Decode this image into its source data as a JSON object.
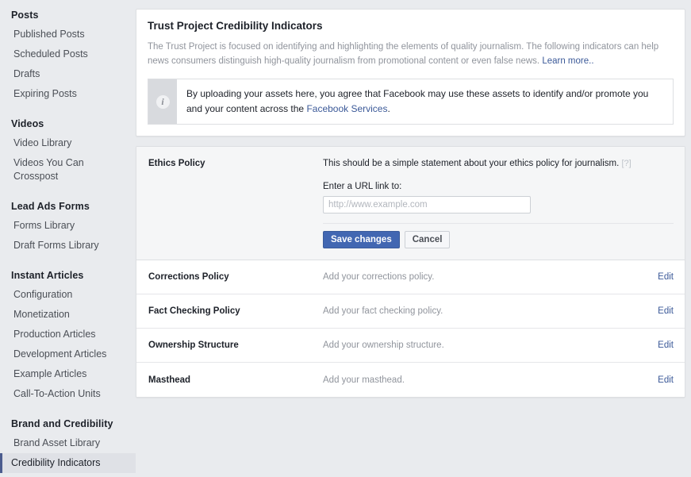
{
  "sidebar": {
    "groups": [
      {
        "header": "Posts",
        "items": [
          {
            "label": "Published Posts",
            "selected": false
          },
          {
            "label": "Scheduled Posts",
            "selected": false
          },
          {
            "label": "Drafts",
            "selected": false
          },
          {
            "label": "Expiring Posts",
            "selected": false
          }
        ]
      },
      {
        "header": "Videos",
        "items": [
          {
            "label": "Video Library",
            "selected": false
          },
          {
            "label": "Videos You Can Crosspost",
            "selected": false
          }
        ]
      },
      {
        "header": "Lead Ads Forms",
        "items": [
          {
            "label": "Forms Library",
            "selected": false
          },
          {
            "label": "Draft Forms Library",
            "selected": false
          }
        ]
      },
      {
        "header": "Instant Articles",
        "items": [
          {
            "label": "Configuration",
            "selected": false
          },
          {
            "label": "Monetization",
            "selected": false
          },
          {
            "label": "Production Articles",
            "selected": false
          },
          {
            "label": "Development Articles",
            "selected": false
          },
          {
            "label": "Example Articles",
            "selected": false
          },
          {
            "label": "Call-To-Action Units",
            "selected": false
          }
        ]
      },
      {
        "header": "Brand and Credibility",
        "items": [
          {
            "label": "Brand Asset Library",
            "selected": false
          },
          {
            "label": "Credibility Indicators",
            "selected": true
          }
        ]
      }
    ]
  },
  "intro": {
    "title": "Trust Project Credibility Indicators",
    "body": "The Trust Project is focused on identifying and highlighting the elements of quality journalism. The following indicators can help news consumers distinguish high-quality journalism from promotional content or even false news.",
    "learn_more": "Learn more..",
    "notice": {
      "icon": "info-icon",
      "text_before": "By uploading your assets here, you agree that Facebook may use these assets to identify and/or promote you and your content across the ",
      "link": "Facebook Services",
      "text_after": "."
    }
  },
  "ethics_section": {
    "label": "Ethics Policy",
    "description": "This should be a simple statement about your ethics policy for journalism.",
    "help": "[?]",
    "field_label": "Enter a URL link to:",
    "input_value": "",
    "input_placeholder": "http://www.example.com",
    "save_label": "Save changes",
    "cancel_label": "Cancel"
  },
  "rows": [
    {
      "label": "Corrections Policy",
      "desc": "Add your corrections policy.",
      "action": "Edit"
    },
    {
      "label": "Fact Checking Policy",
      "desc": "Add your fact checking policy.",
      "action": "Edit"
    },
    {
      "label": "Ownership Structure",
      "desc": "Add your ownership structure.",
      "action": "Edit"
    },
    {
      "label": "Masthead",
      "desc": "Add your masthead.",
      "action": "Edit"
    }
  ],
  "colors": {
    "page_bg": "#e9ebee",
    "card_bg": "#ffffff",
    "accent_link": "#3b5998",
    "primary_button": "#4267b2",
    "selected_border": "#4b5c8e",
    "muted_text": "#90949c"
  }
}
